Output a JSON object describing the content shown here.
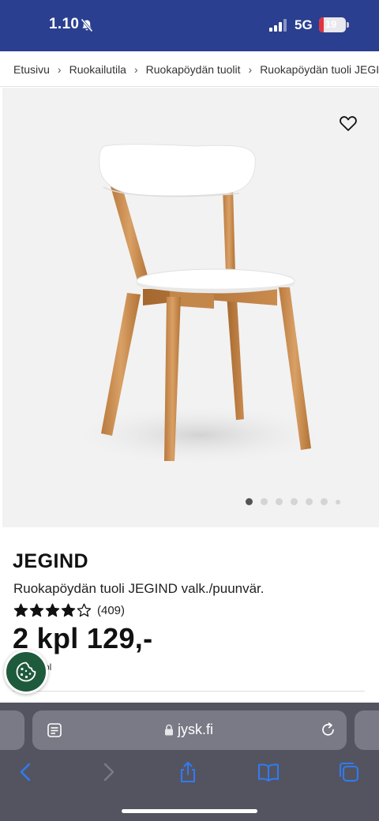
{
  "status_bar": {
    "time": "1.10",
    "network": "5G",
    "battery_level": "19",
    "battery_percent": 19
  },
  "breadcrumb": [
    "Etusivu",
    "Ruokailutila",
    "Ruokapöydän tuolit",
    "Ruokapöydän tuoli JEGIND"
  ],
  "gallery": {
    "total_images": 7,
    "active_index": 0
  },
  "product": {
    "brand": "JEGIND",
    "name": "Ruokapöydän tuoli JEGIND valk./puunvär.",
    "rating": 4,
    "rating_max": 5,
    "review_count": "(409)",
    "price": "2 kpl 129,-",
    "unit_text": "pl"
  },
  "browser": {
    "url": "jysk.fi"
  },
  "colors": {
    "status_bar": "#2a3f8f",
    "accent_blue": "#2f7bf5",
    "cookie_button": "#1e5a3c",
    "battery_low": "#e0333f"
  },
  "icons": {
    "wishlist": "heart-outline-icon",
    "cookie": "cookie-icon",
    "reader": "reader-mode-icon",
    "lock": "lock-icon",
    "reload": "reload-icon",
    "back": "back-icon",
    "forward": "forward-icon",
    "share": "share-icon",
    "bookmarks": "bookmarks-icon",
    "tabs": "tabs-icon"
  }
}
